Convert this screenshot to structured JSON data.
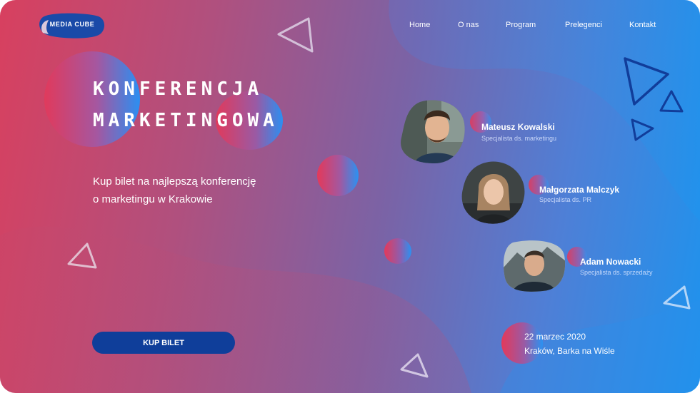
{
  "brand": {
    "logo_text": "MEDIA CUBE"
  },
  "nav": {
    "items": [
      {
        "label": "Home"
      },
      {
        "label": "O nas"
      },
      {
        "label": "Program"
      },
      {
        "label": "Prelegenci"
      },
      {
        "label": "Kontakt"
      }
    ]
  },
  "hero": {
    "title_line1": "KONFERENCJA",
    "title_line2": "MARKETINGOWA",
    "subtitle_line1": "Kup bilet na najlepszą konferencję",
    "subtitle_line2": "o marketingu w Krakowie",
    "cta_label": "KUP BILET"
  },
  "speakers": [
    {
      "name": "Mateusz Kowalski",
      "role": "Specjalista ds. marketingu"
    },
    {
      "name": "Małgorzata Malczyk",
      "role": "Specjalista ds. PR"
    },
    {
      "name": "Adam Nowacki",
      "role": "Specjalista ds. sprzedaży"
    }
  ],
  "event": {
    "date": "22 marzec 2020",
    "place": "Kraków, Barka na Wiśle"
  },
  "colors": {
    "gradient_start": "#d8405f",
    "gradient_end": "#1d93ee",
    "button": "#0f3e9a",
    "logo_blob": "#1a4aa8"
  }
}
